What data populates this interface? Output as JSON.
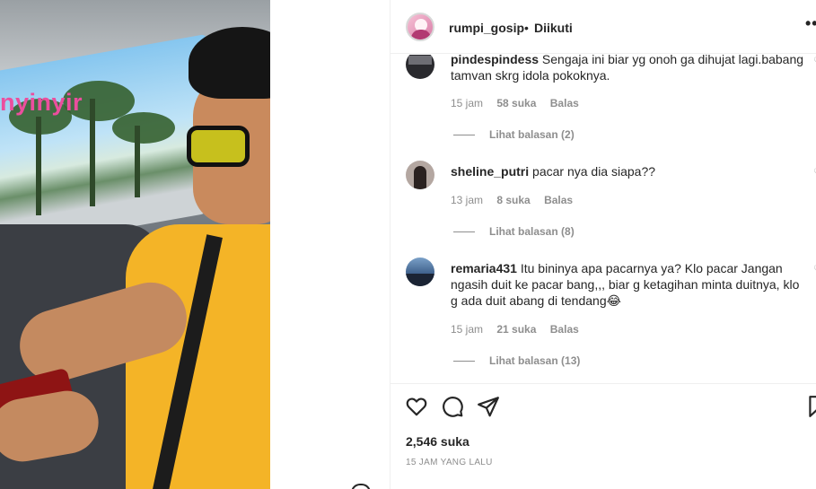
{
  "video": {
    "watermark": "nyinyir"
  },
  "header": {
    "username": "rumpi_gosip",
    "separator": "•",
    "follow_status": "Diikuti",
    "more": "•••"
  },
  "comments": [
    {
      "username": "pindespindess",
      "text": "Sengaja ini biar yg onoh ga dihujat lagi.babang tamvan skrg idola pokoknya.",
      "time": "15 jam",
      "likes": "58 suka",
      "reply": "Balas",
      "view_replies": "Lihat balasan (2)"
    },
    {
      "username": "sheline_putri",
      "text": "pacar nya dia siapa??",
      "time": "13 jam",
      "likes": "8 suka",
      "reply": "Balas",
      "view_replies": "Lihat balasan (8)"
    },
    {
      "username": "remaria431",
      "text": "Itu bininya apa pacarnya ya? Klo pacar Jangan ngasih duit ke pacar bang,,, biar g ketagihan minta duitnya, klo g ada duit abang di tendang😂",
      "time": "15 jam",
      "likes": "21 suka",
      "reply": "Balas",
      "view_replies": "Lihat balasan (13)"
    }
  ],
  "actions": {
    "icons": [
      "heart-icon",
      "comment-icon",
      "share-icon",
      "bookmark-icon"
    ],
    "likes_count": "2,546 suka",
    "timestamp": "15 JAM YANG LALU"
  }
}
